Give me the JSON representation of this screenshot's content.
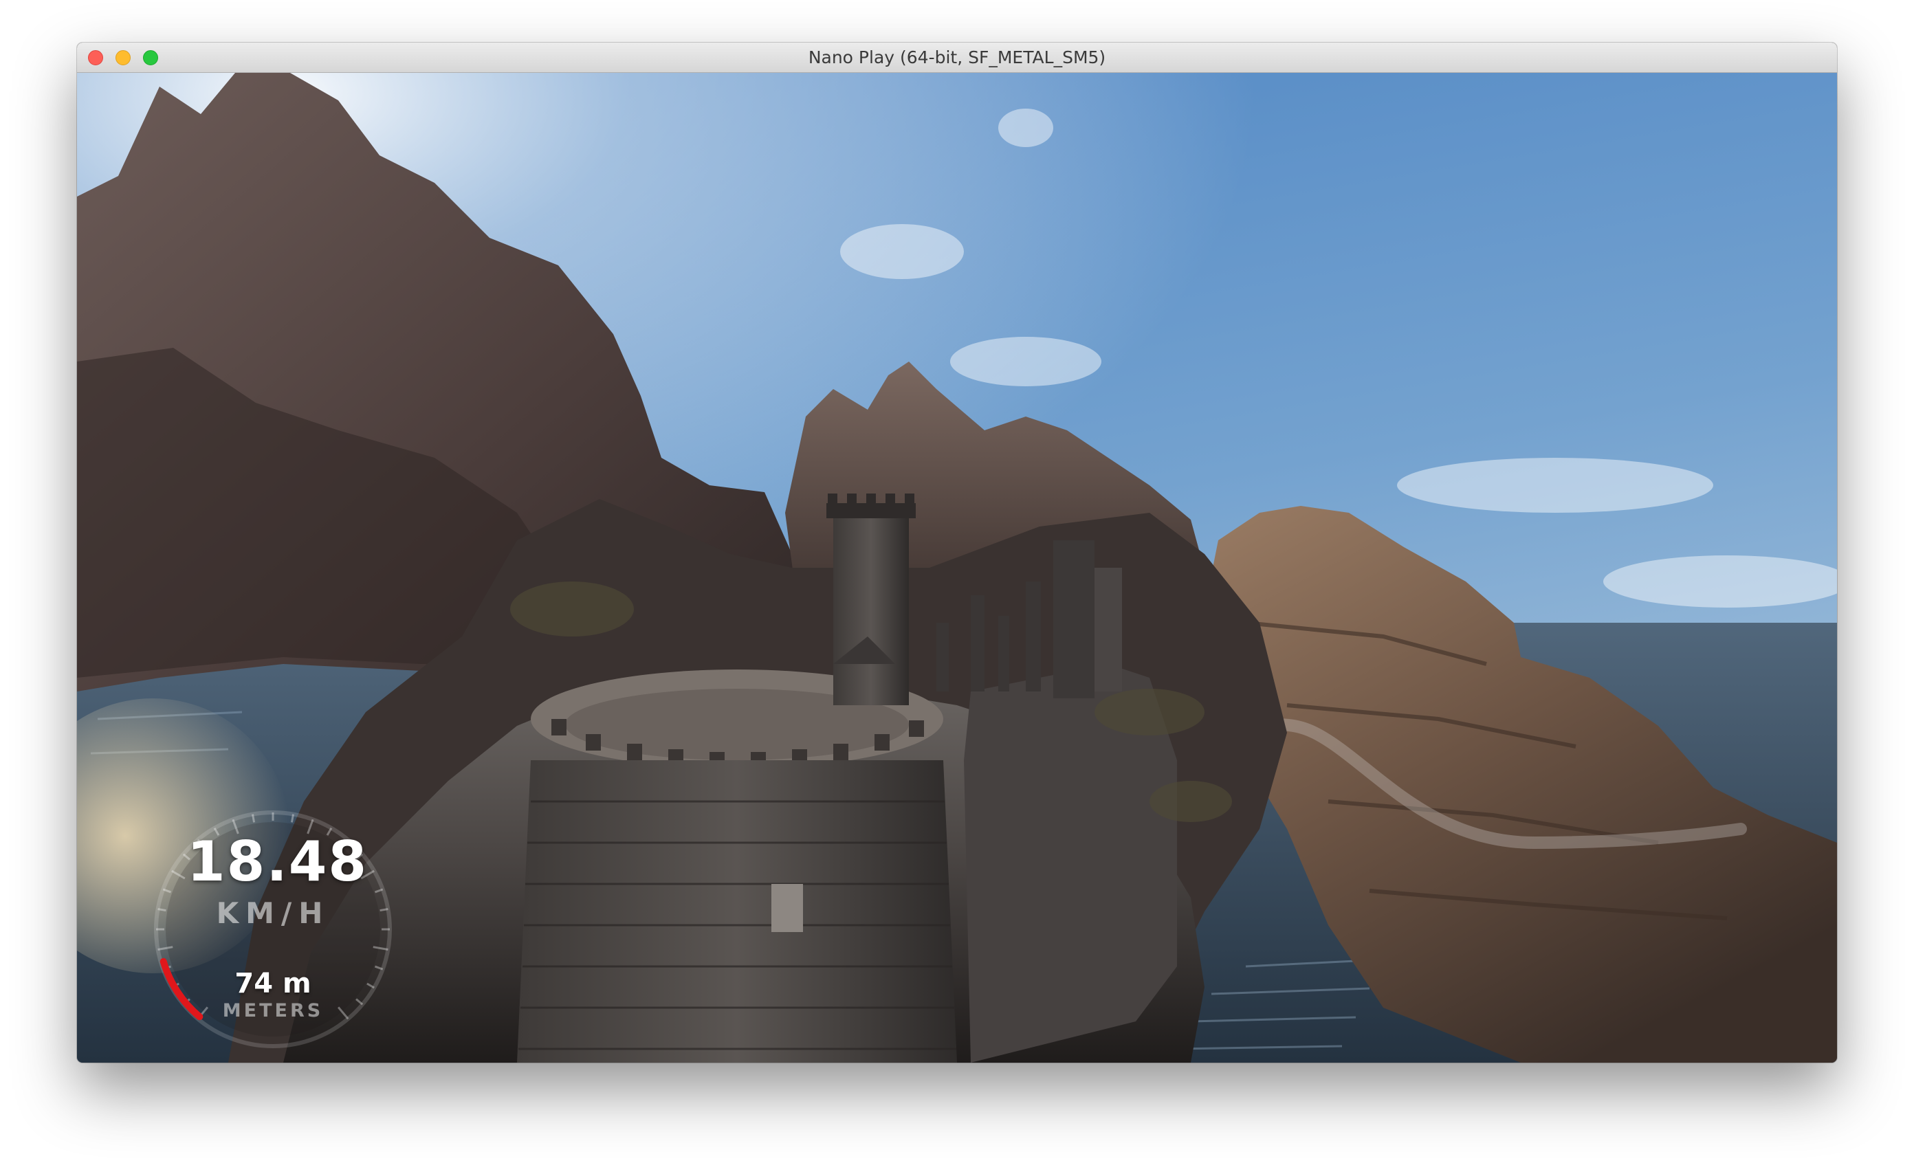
{
  "window": {
    "title": "Nano Play (64-bit, SF_METAL_SM5)"
  },
  "hud": {
    "speed_value": "18.48",
    "speed_unit": "KM/H",
    "distance_value": "74 m",
    "distance_unit": "METERS",
    "speed_gauge_fill_fraction": 0.12,
    "gauge_accent_color": "#e0171b"
  },
  "scene": {
    "sky_color": "#6c9ccc",
    "water_color": "#3e5468",
    "rock_color": "#5a4a44"
  }
}
